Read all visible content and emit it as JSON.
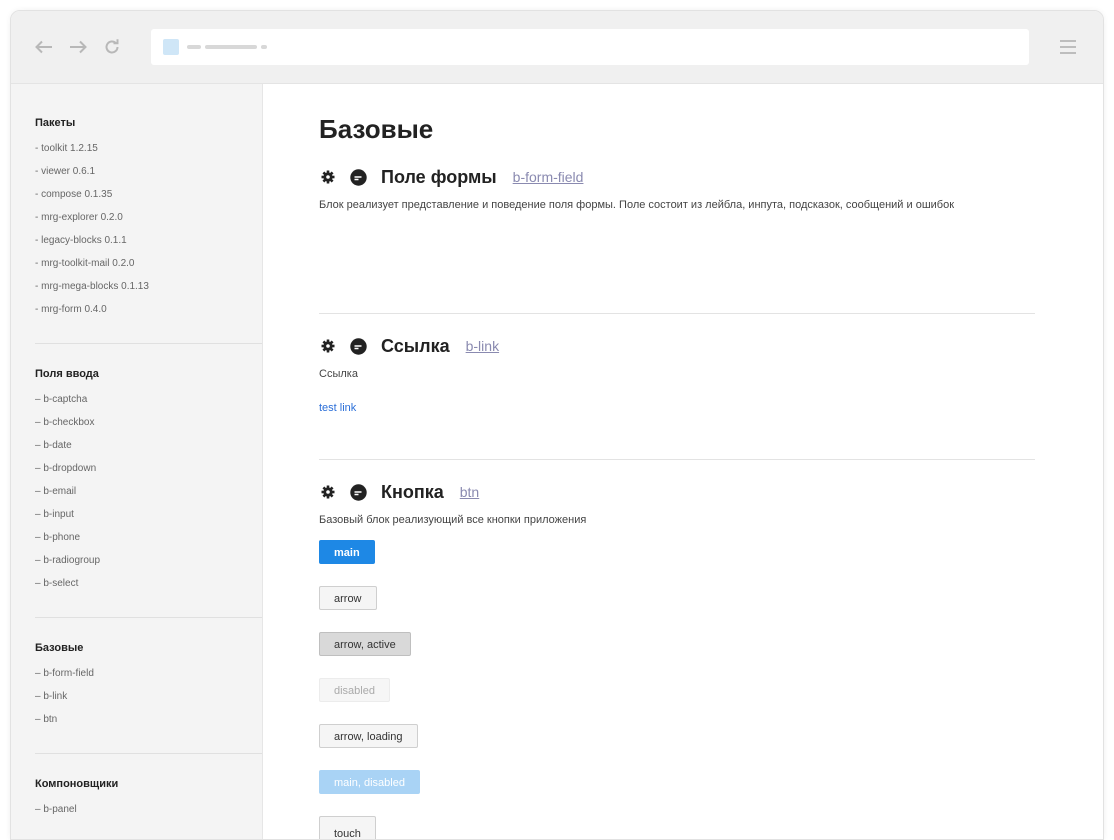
{
  "sidebar": {
    "sections": [
      {
        "title": "Пакеты",
        "items": [
          "- toolkit 1.2.15",
          "- viewer 0.6.1",
          "- compose 0.1.35",
          "- mrg-explorer 0.2.0",
          "- legacy-blocks 0.1.1",
          "- mrg-toolkit-mail 0.2.0",
          "- mrg-mega-blocks 0.1.13",
          "- mrg-form 0.4.0"
        ]
      },
      {
        "title": "Поля ввода",
        "items": [
          "– b-captcha",
          "– b-checkbox",
          "– b-date",
          "– b-dropdown",
          "– b-email",
          "– b-input",
          "– b-phone",
          "– b-radiogroup",
          "– b-select"
        ]
      },
      {
        "title": "Базовые",
        "items": [
          "– b-form-field",
          "– b-link",
          "– btn"
        ]
      },
      {
        "title": "Компоновщики",
        "items": [
          "– b-panel"
        ]
      }
    ]
  },
  "main": {
    "title": "Базовые",
    "blocks": [
      {
        "name": "Поле формы",
        "id": "b-form-field",
        "description": "Блок реализует представление и поведение поля формы. Поле состоит из лейбла, инпута, подсказок, сообщений и ошибок"
      },
      {
        "name": "Ссылка",
        "id": "b-link",
        "description": "Ссылка",
        "example_link": "test link"
      },
      {
        "name": "Кнопка",
        "id": "btn",
        "description": "Базовый блок реализующий все кнопки приложения",
        "buttons": [
          "main",
          "arrow",
          "arrow, active",
          "disabled",
          "arrow, loading",
          "main, disabled",
          "touch"
        ]
      }
    ]
  },
  "icons": {
    "gear": "gear-icon",
    "ruler": "ruler-icon",
    "back": "back-arrow-icon",
    "forward": "forward-arrow-icon",
    "reload": "reload-icon",
    "menu": "hamburger-menu-icon"
  },
  "colors": {
    "accent": "#1e88e5",
    "link": "#2a6ed8",
    "sidebar_bg": "#f4f4f4"
  }
}
